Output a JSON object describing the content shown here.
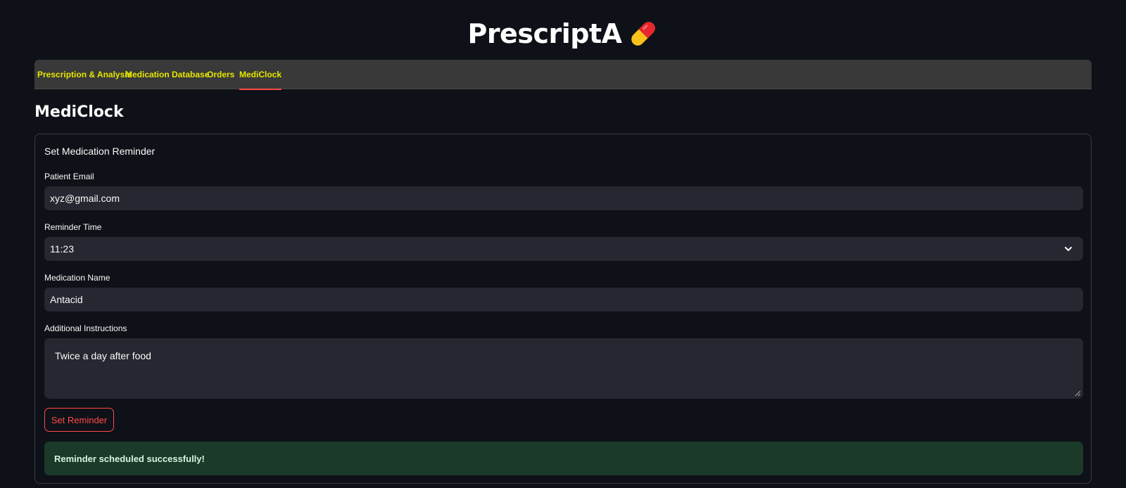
{
  "header": {
    "title": "PrescriptA",
    "logo_icon": "pill-icon",
    "colors": {
      "pill_red": "#e8262e",
      "pill_yellow": "#f8c21b"
    }
  },
  "tabs": [
    {
      "label": "Prescription & Analysis",
      "active": false
    },
    {
      "label": "Medication Database",
      "active": false
    },
    {
      "label": "Orders",
      "active": false
    },
    {
      "label": "MediClock",
      "active": true
    }
  ],
  "page": {
    "heading": "MediClock"
  },
  "form": {
    "title": "Set Medication Reminder",
    "email": {
      "label": "Patient Email",
      "value": "xyz@gmail.com"
    },
    "time": {
      "label": "Reminder Time",
      "value": "11:23",
      "icon": "chevron-down-icon"
    },
    "medication": {
      "label": "Medication Name",
      "value": "Antacid"
    },
    "instructions": {
      "label": "Additional Instructions",
      "value": "Twice a day after food"
    },
    "submit_label": "Set Reminder",
    "success_message": "Reminder scheduled successfully!"
  },
  "colors": {
    "background": "#0e1117",
    "tab_text": "#e6e600",
    "accent": "#ff4b4b",
    "input_bg": "#262730",
    "success_bg": "#1b3a29"
  }
}
